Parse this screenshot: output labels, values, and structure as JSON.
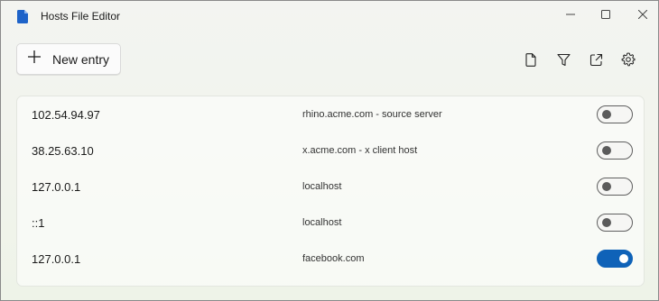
{
  "window": {
    "title": "Hosts File Editor",
    "app_icon": "document-icon",
    "controls": [
      "minimize-icon",
      "maximize-icon",
      "close-icon"
    ]
  },
  "toolbar": {
    "new_entry_label": "New entry",
    "new_entry_icon": "plus-icon",
    "icons": [
      "file-icon",
      "filter-icon",
      "open-external-icon",
      "settings-gear-icon"
    ]
  },
  "entries": [
    {
      "address": "102.54.94.97",
      "host": "rhino.acme.com - source server",
      "enabled": false
    },
    {
      "address": "38.25.63.10",
      "host": "x.acme.com - x client host",
      "enabled": false
    },
    {
      "address": "127.0.0.1",
      "host": "localhost",
      "enabled": false
    },
    {
      "address": "::1",
      "host": "localhost",
      "enabled": false
    },
    {
      "address": "127.0.0.1",
      "host": "facebook.com",
      "enabled": true
    }
  ],
  "colors": {
    "accent": "#0f62b8",
    "app_icon": "#1e63c9"
  }
}
